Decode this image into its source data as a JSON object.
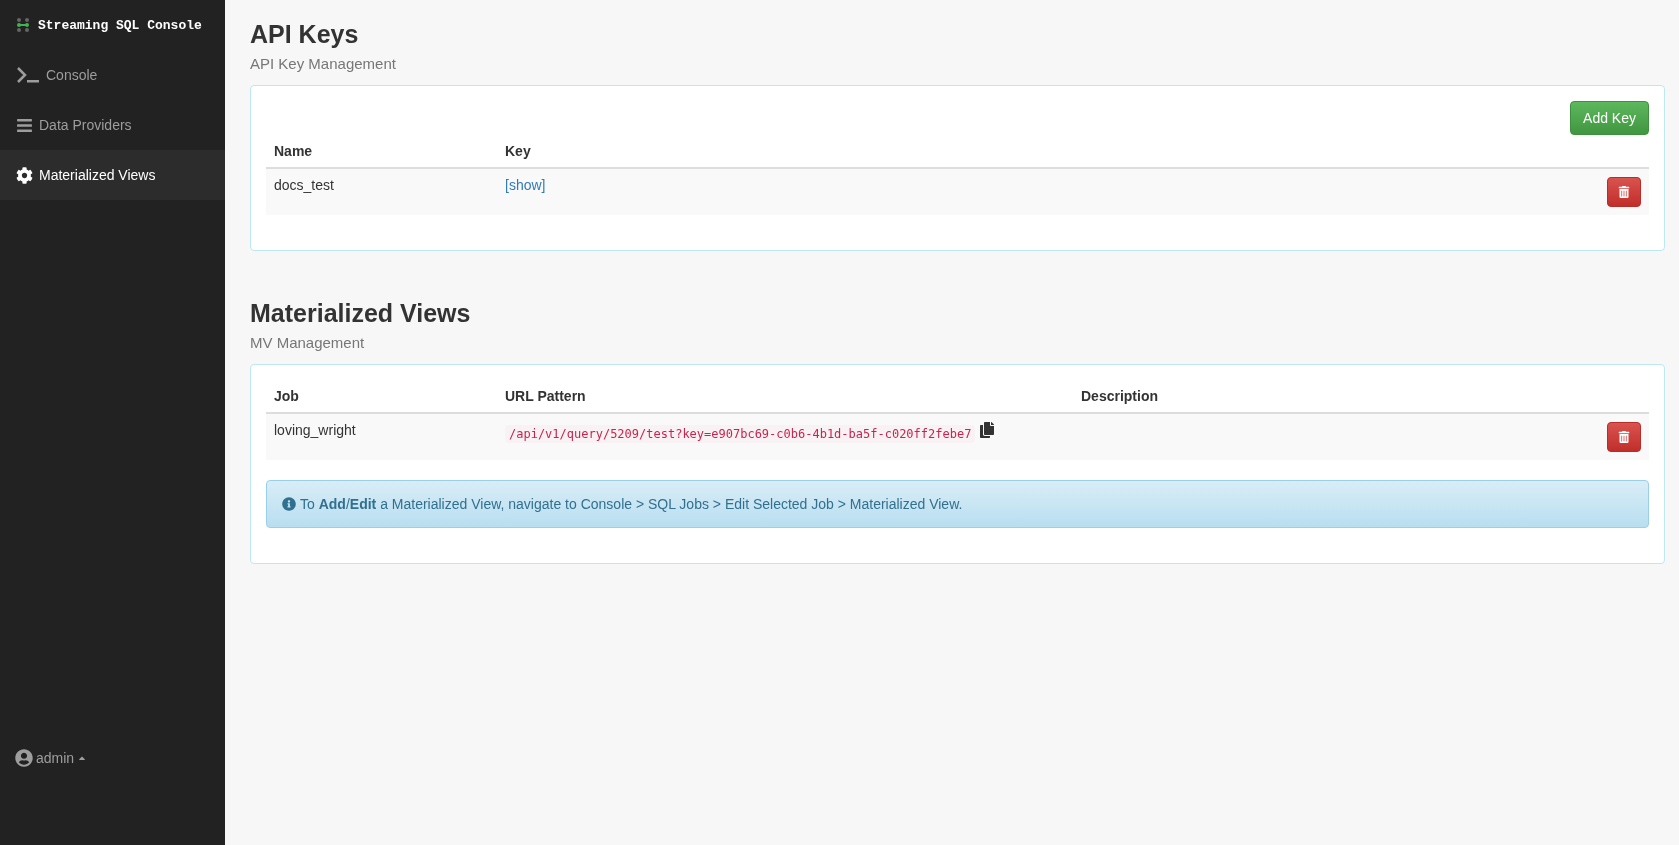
{
  "app": {
    "title": "Streaming SQL Console"
  },
  "sidebar": {
    "items": [
      {
        "label": "Console",
        "kind": "console",
        "selected": false
      },
      {
        "label": "Data Providers",
        "kind": "list",
        "selected": false
      },
      {
        "label": "Materialized Views",
        "kind": "gear",
        "selected": true
      }
    ],
    "user": "admin"
  },
  "api_keys": {
    "title": "API Keys",
    "subtitle": "API Key Management",
    "add_button": "Add Key",
    "columns": [
      "Name",
      "Key"
    ],
    "rows": [
      {
        "name": "docs_test",
        "key": "[show]"
      }
    ]
  },
  "materialized_views": {
    "title": "Materialized Views",
    "subtitle": "MV Management",
    "columns": [
      "Job",
      "URL Pattern",
      "Description"
    ],
    "rows": [
      {
        "job": "loving_wright",
        "url": "/api/v1/query/5209/test?key=e907bc69-c0b6-4b1d-ba5f-c020ff2febe7"
      }
    ],
    "info": "To **Add**/**Edit** a Materialized View, navigate to Console > SQL Jobs > Edit Selected Job > Materialized View."
  }
}
